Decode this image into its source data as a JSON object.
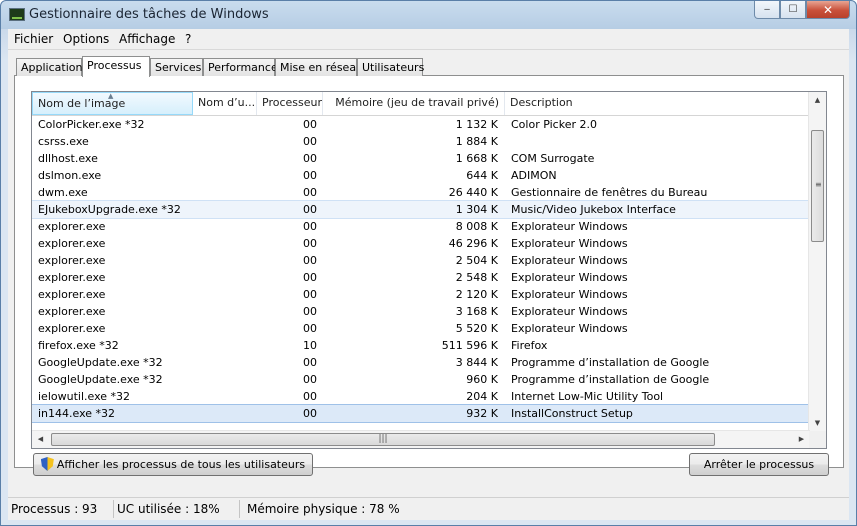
{
  "window": {
    "title": "Gestionnaire des tâches de Windows",
    "minimize": "‒",
    "maximize": "☐",
    "close": "✕"
  },
  "menu": [
    "Fichier",
    "Options",
    "Affichage",
    "?"
  ],
  "tabs": [
    "Applications",
    "Processus",
    "Services",
    "Performance",
    "Mise en réseau",
    "Utilisateurs"
  ],
  "active_tab": "Processus",
  "columns": [
    "Nom de l’image",
    "Nom d’u...",
    "Processeur",
    "Mémoire (jeu de travail privé)",
    "Description"
  ],
  "processes": [
    {
      "name": "ColorPicker.exe *32",
      "user": "",
      "cpu": "00",
      "mem": "1 132 K",
      "desc": "Color Picker 2.0"
    },
    {
      "name": "csrss.exe",
      "user": "",
      "cpu": "00",
      "mem": "1 884 K",
      "desc": ""
    },
    {
      "name": "dllhost.exe",
      "user": "",
      "cpu": "00",
      "mem": "1 668 K",
      "desc": "COM Surrogate"
    },
    {
      "name": "dslmon.exe",
      "user": "",
      "cpu": "00",
      "mem": "644 K",
      "desc": "ADIMON"
    },
    {
      "name": "dwm.exe",
      "user": "",
      "cpu": "00",
      "mem": "26 440 K",
      "desc": "Gestionnaire de fenêtres du Bureau"
    },
    {
      "name": "EJukeboxUpgrade.exe *32",
      "user": "",
      "cpu": "00",
      "mem": "1 304 K",
      "desc": "Music/Video Jukebox Interface"
    },
    {
      "name": "explorer.exe",
      "user": "",
      "cpu": "00",
      "mem": "8 008 K",
      "desc": "Explorateur Windows"
    },
    {
      "name": "explorer.exe",
      "user": "",
      "cpu": "00",
      "mem": "46 296 K",
      "desc": "Explorateur Windows"
    },
    {
      "name": "explorer.exe",
      "user": "",
      "cpu": "00",
      "mem": "2 504 K",
      "desc": "Explorateur Windows"
    },
    {
      "name": "explorer.exe",
      "user": "",
      "cpu": "00",
      "mem": "2 548 K",
      "desc": "Explorateur Windows"
    },
    {
      "name": "explorer.exe",
      "user": "",
      "cpu": "00",
      "mem": "2 120 K",
      "desc": "Explorateur Windows"
    },
    {
      "name": "explorer.exe",
      "user": "",
      "cpu": "00",
      "mem": "3 168 K",
      "desc": "Explorateur Windows"
    },
    {
      "name": "explorer.exe",
      "user": "",
      "cpu": "00",
      "mem": "5 520 K",
      "desc": "Explorateur Windows"
    },
    {
      "name": "firefox.exe *32",
      "user": "",
      "cpu": "10",
      "mem": "511 596 K",
      "desc": "Firefox"
    },
    {
      "name": "GoogleUpdate.exe *32",
      "user": "",
      "cpu": "00",
      "mem": "3 844 K",
      "desc": "Programme d’installation de Google"
    },
    {
      "name": "GoogleUpdate.exe *32",
      "user": "",
      "cpu": "00",
      "mem": "960 K",
      "desc": "Programme d’installation de Google"
    },
    {
      "name": "ielowutil.exe *32",
      "user": "",
      "cpu": "00",
      "mem": "204 K",
      "desc": "Internet Low-Mic Utility Tool"
    },
    {
      "name": "in144.exe *32",
      "user": "",
      "cpu": "00",
      "mem": "932 K",
      "desc": "InstallConstruct Setup"
    }
  ],
  "buttons": {
    "show_all": "Afficher les processus de tous les utilisateurs",
    "end_process": "Arrêter le processus"
  },
  "status": {
    "processes": "Processus : 93",
    "cpu": "UC utilisée : 18%",
    "memory": "Mémoire physique : 78 %"
  },
  "icons": {
    "app": "task-manager-icon",
    "shield": "uac-shield-icon"
  },
  "colors": {
    "selection": "#dce9f8",
    "hover": "#eef4fb",
    "close_button": "#c9503a"
  }
}
